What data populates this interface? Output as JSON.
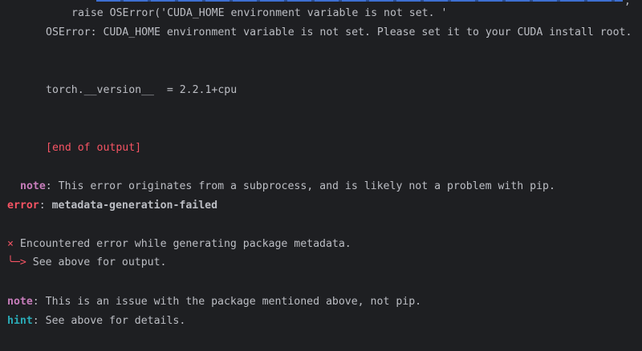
{
  "terminal": {
    "tail_char": ",",
    "raise_line": "raise OSError('CUDA_HOME environment variable is not set. '",
    "oserror_line": "OSError: CUDA_HOME environment variable is not set. Please set it to your CUDA install root.",
    "torch_version_line": "torch.__version__  = 2.2.1+cpu",
    "end_of_output": "[end of output]",
    "note1": {
      "label": "note",
      "text": ": This error originates from a subprocess, and is likely not a problem with pip."
    },
    "error": {
      "label": "error",
      "sep": ": ",
      "code": "metadata-generation-failed"
    },
    "encountered": {
      "mark": "×",
      "text": " Encountered error while generating package metadata."
    },
    "see_above": {
      "arrow": "╰─>",
      "text": " See above for output."
    },
    "note2": {
      "label": "note",
      "text": ": This is an issue with the package mentioned above, not pip."
    },
    "hint": {
      "label": "hint",
      "text": ": See above for details."
    }
  }
}
